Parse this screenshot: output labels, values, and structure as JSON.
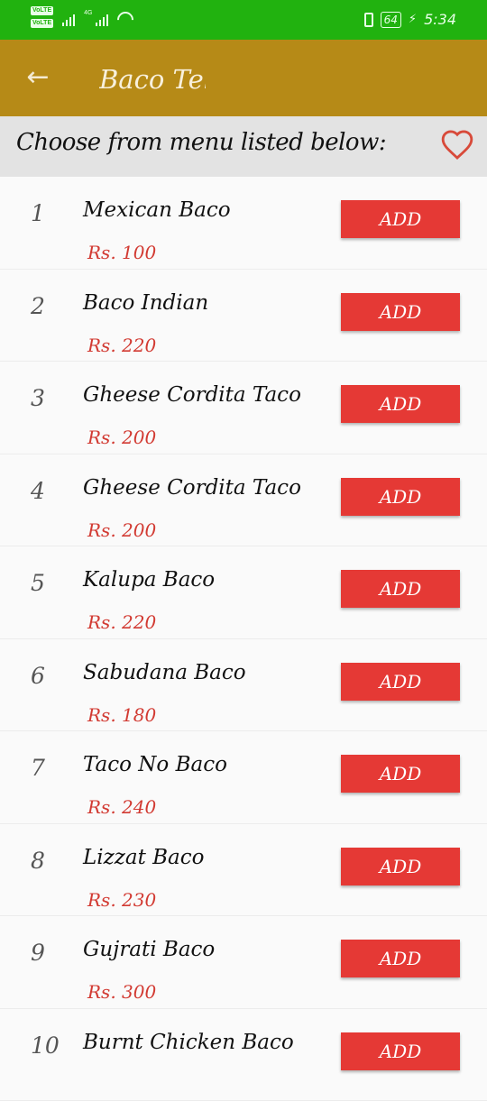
{
  "status_bar": {
    "volte_label": "VoLTE",
    "network": "4G",
    "battery": "64",
    "time": "5:34"
  },
  "app_bar": {
    "title": "Baco Teli",
    "back_icon": "arrow-left-icon",
    "color": "#b68a17"
  },
  "header": {
    "text": "Choose from menu listed below:",
    "favorite_icon": "heart-outline-icon"
  },
  "menu": [
    {
      "num": "1",
      "name": "Mexican Baco",
      "price": "Rs. 100",
      "button": "ADD"
    },
    {
      "num": "2",
      "name": "Baco Indian",
      "price": "Rs. 220",
      "button": "ADD"
    },
    {
      "num": "3",
      "name": "Gheese Cordita Taco",
      "price": "Rs. 200",
      "button": "ADD"
    },
    {
      "num": "4",
      "name": "Gheese Cordita Taco",
      "price": "Rs. 200",
      "button": "ADD"
    },
    {
      "num": "5",
      "name": "Kalupa Baco",
      "price": "Rs. 220",
      "button": "ADD"
    },
    {
      "num": "6",
      "name": "Sabudana Baco",
      "price": "Rs. 180",
      "button": "ADD"
    },
    {
      "num": "7",
      "name": "Taco No Baco",
      "price": "Rs. 240",
      "button": "ADD"
    },
    {
      "num": "8",
      "name": "Lizzat Baco",
      "price": "Rs. 230",
      "button": "ADD"
    },
    {
      "num": "9",
      "name": "Gujrati Baco",
      "price": "Rs. 300",
      "button": "ADD"
    },
    {
      "num": "10",
      "name": "Burnt Chicken Baco",
      "price": "",
      "button": "ADD"
    }
  ],
  "colors": {
    "status_bar": "#21b20f",
    "add_button": "#e53935",
    "price_text": "#d23a32"
  }
}
